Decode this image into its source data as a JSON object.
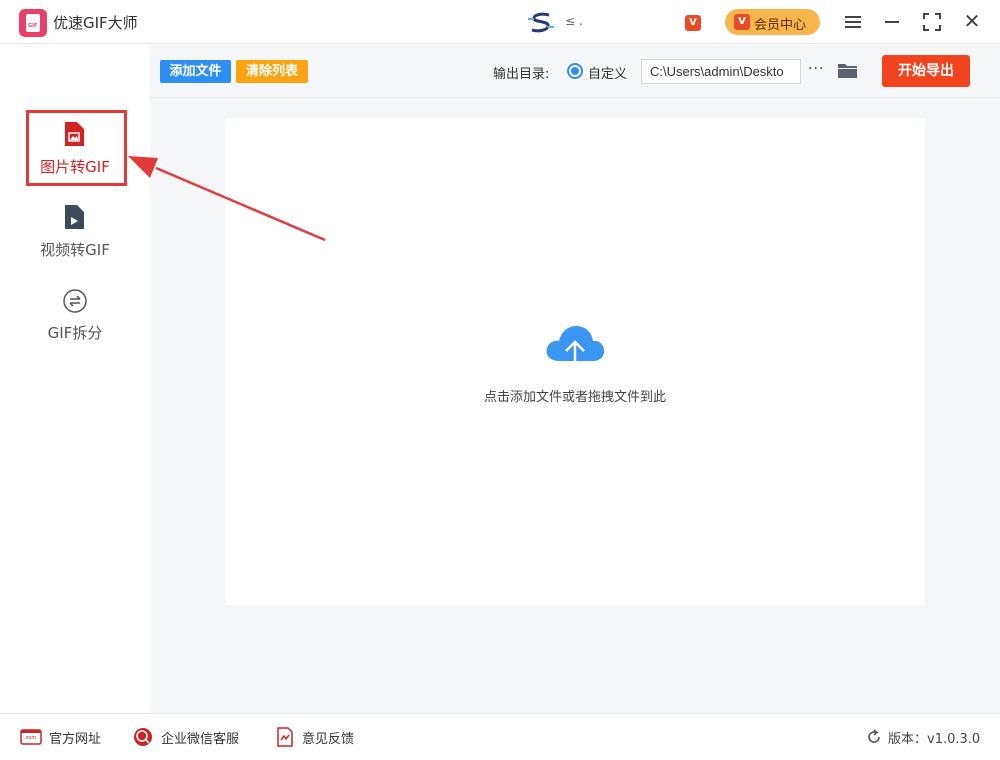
{
  "window": {
    "app_title": "优速GIF大师",
    "logo_text": "GIF",
    "user_name": "≤ .",
    "vip_badge": "V",
    "vip_center_label": "会员中心"
  },
  "sidebar": {
    "items": [
      {
        "label": "图片转GIF",
        "icon": "image-file-icon",
        "active": true
      },
      {
        "label": "视频转GIF",
        "icon": "video-file-icon",
        "active": false
      },
      {
        "label": "GIF拆分",
        "icon": "split-icon",
        "active": false
      }
    ]
  },
  "toolbar": {
    "add_files": "添加文件",
    "clear_list": "清除列表",
    "output_dir_label": "输出目录:",
    "custom_option": "自定义",
    "output_path": "C:\\Users\\admin\\Deskto",
    "more": "···",
    "start_export": "开始导出"
  },
  "dropzone": {
    "hint": "点击添加文件或者拖拽文件到此"
  },
  "footer": {
    "website": "官方网址",
    "website_icon_text": ".com",
    "wechat_support": "企业微信客服",
    "feedback": "意见反馈",
    "version_label": "版本：v1.0.3.0"
  },
  "colors": {
    "accent_blue": "#2e8ef2",
    "accent_orange": "#fba413",
    "export_red": "#f1431d",
    "active_red": "#d32222",
    "vip_gold": "#f7b54c"
  }
}
